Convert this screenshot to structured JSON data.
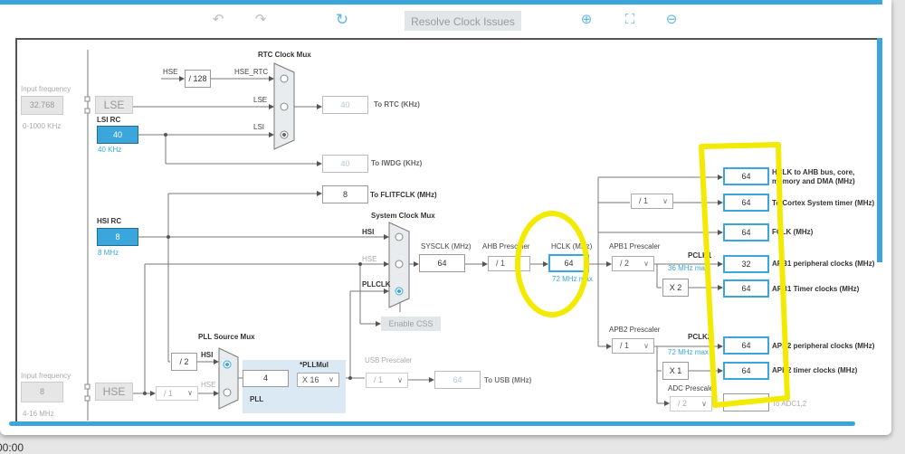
{
  "toolbar": {
    "undo_icon": "undo-icon",
    "redo_icon": "redo-icon",
    "refresh_icon": "refresh-icon",
    "resolve_label": "Resolve Clock Issues",
    "zoom_in_icon": "zoom-in-icon",
    "fit_icon": "fit-screen-icon",
    "zoom_out_icon": "zoom-out-icon"
  },
  "lse": {
    "input_label": "Input frequency",
    "input_value": "32.768",
    "range": "0-1000 KHz",
    "label": "LSE"
  },
  "lsi": {
    "label": "LSI RC",
    "value": "40",
    "unit": "40 KHz"
  },
  "rtc_mux": {
    "title": "RTC Clock Mux",
    "hse": "HSE",
    "div": "/ 128",
    "hse_rtc": "HSE_RTC",
    "lse": "LSE",
    "lsi": "LSI",
    "selected": "LSI"
  },
  "rtc_out": {
    "value": "40",
    "label": "To RTC (KHz)"
  },
  "iwdg_out": {
    "value": "40",
    "label": "To IWDG (KHz)"
  },
  "flit_out": {
    "value": "8",
    "label": "To FLITFCLK (MHz)"
  },
  "hsi": {
    "label": "HSI RC",
    "value": "8",
    "unit": "8 MHz"
  },
  "sys_mux": {
    "title": "System Clock Mux",
    "hsi": "HSI",
    "hse": "HSE",
    "pllclk": "PLLCLK",
    "selected": "PLLCLK"
  },
  "sysclk": {
    "label": "SYSCLK (MHz)",
    "value": "64"
  },
  "ahb": {
    "label": "AHB Prescaler",
    "value": "/ 1"
  },
  "hclk": {
    "label": "HCLK (MHz)",
    "value": "64",
    "max": "72 MHz max"
  },
  "apb1": {
    "label": "APB1 Prescaler",
    "value": "/ 2",
    "pclk": "PCLK1",
    "max": "36 MHz max",
    "mult": "X 2"
  },
  "apb2": {
    "label": "APB2 Prescaler",
    "value": "/ 1",
    "pclk": "PCLK2",
    "max": "72 MHz max",
    "mult": "X 1"
  },
  "adc": {
    "label": "ADC Prescaler",
    "value": "/ 2",
    "out_label": "To ADC1,2"
  },
  "cortex_div": "/ 1",
  "outputs": [
    {
      "value": "64",
      "label": "HCLK to AHB bus, core, memory and DMA (MHz)"
    },
    {
      "value": "64",
      "label": "To Cortex System timer (MHz)"
    },
    {
      "value": "64",
      "label": "FCLK (MHz)"
    },
    {
      "value": "32",
      "label": "APB1 peripheral clocks (MHz)"
    },
    {
      "value": "64",
      "label": "APB1 Timer clocks (MHz)"
    },
    {
      "value": "64",
      "label": "APB2 peripheral clocks (MHz)"
    },
    {
      "value": "64",
      "label": "APB2 timer clocks (MHz)"
    }
  ],
  "enable_css": "Enable CSS",
  "pll_mux": {
    "title": "PLL Source Mux",
    "div": "/ 2",
    "hsi": "HSI",
    "hse": "HSE",
    "selected": "HSI"
  },
  "pll": {
    "label": "PLL",
    "value": "4",
    "mul_label": "*PLLMul",
    "mul": "X 16"
  },
  "usb": {
    "label": "USB Prescaler",
    "value": "/ 1",
    "out": "64",
    "out_label": "To USB (MHz)"
  },
  "hse": {
    "input_label": "Input frequency",
    "input_value": "8",
    "range": "4-16 MHz",
    "label": "HSE",
    "div": "/ 1"
  },
  "clock_text": "00:00",
  "colors": {
    "accent": "#3aa6dc",
    "annotation": "#f2ea00"
  }
}
